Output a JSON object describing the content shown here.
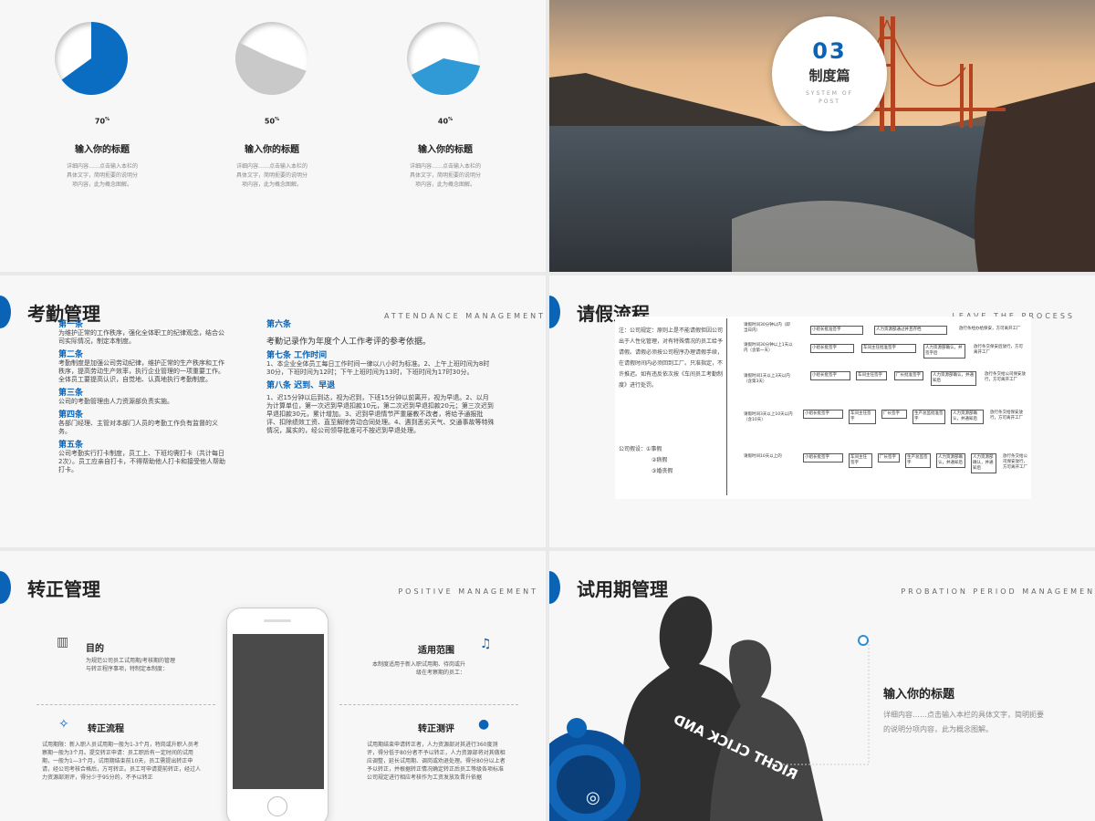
{
  "slide1": {
    "items": [
      {
        "percent_label": "70",
        "percent": 70,
        "color": "#0a6dc2",
        "title": "输入你的标题",
        "desc_lines": [
          "详细内容……点击输入本栏的",
          "具体文字，简明扼要的说明分",
          "项内容，此为概念图解。"
        ]
      },
      {
        "percent_label": "50",
        "percent": 50,
        "color": "#c9c9c9",
        "title": "输入你的标题",
        "desc_lines": [
          "详细内容……点击输入本栏的",
          "具体文字，简明扼要的说明分",
          "项内容，此为概念图解。"
        ]
      },
      {
        "percent_label": "40",
        "percent": 40,
        "color": "#2f9ad6",
        "title": "输入你的标题",
        "desc_lines": [
          "详细内容……点击输入本栏的",
          "具体文字，简明扼要的说明分",
          "项内容，此为概念图解。"
        ]
      }
    ]
  },
  "slide2": {
    "number": "03",
    "title": "制度篇",
    "subtitle": "SYSTEM OF POST"
  },
  "slide3": {
    "title": "考勤管理",
    "subtitle": "ATTENDANCE MANAGEMENT",
    "left": [
      {
        "head": "第一条",
        "body": "为维护正常的工作秩序，强化全体职工的纪律观念，结合公司实际情况，制定本制度。"
      },
      {
        "head": "第二条",
        "body": "考勤制度是加强公司劳动纪律，维护正常的生产秩序和工作秩序，提高劳动生产效率，执行企业管理的一项重要工作。全体员工要提高认识，自觉地、认真地执行考勤制度。"
      },
      {
        "head": "第三条",
        "body": "公司的考勤管理由人力资源部负责实施。"
      },
      {
        "head": "第四条",
        "body": "各部门经理、主管对本部门人员的考勤工作负有监督的义务。"
      },
      {
        "head": "第五条",
        "body": "公司考勤实行打卡制度，员工上、下班均需打卡（共计每日2次）。员工应亲自打卡，不得帮助他人打卡和接受他人帮助打卡。"
      }
    ],
    "right": {
      "h6": "第六条",
      "p6": "考勤记录作为年度个人工作考评的参考依据。",
      "h7": "第七条 工作时间",
      "p7": "1、本企业全体员工每日工作时间一律以八小时为标准。2、上午上班时间为8时30分，下班时间为12时；下午上班时间为13时，下班时间为17时30分。",
      "h8": "第八条 迟到、早退",
      "p8": "1、迟15分钟以后到达，视为迟到，下班15分钟以前离开，视为早退。2、以月为计算单位，第一次迟到早退扣款10元，第二次迟到早退扣款20元；第三次迟到早退扣款30元，累计增加。3、迟到早退情节严重屡教不改者，将给予通报批评、扣除绩效工资、直至解除劳动合同处理。4、遇到恶劣天气、交通事故等特殊情况，属实的，经公司领导批准可不按迟到早退处理。"
    }
  },
  "slide4": {
    "title": "请假流程",
    "subtitle": "LEAVE THE PROCESS",
    "rules": "注：公司规定：原则上是不能请假但因公司出于人性化管理，对有特殊情况的员工给予请假。请假必须按公司程序办理请假手续，在请假时间内必须回到工厂。只准指定，不许推迟。如有违反依次按《车间员工考勤制度》进行处罚。",
    "types_label": "公司假设：",
    "types": [
      "①事假",
      "②病假",
      "③婚丧假"
    ],
    "rows": [
      {
        "cond": "请假时间30分钟以内（即当日内）",
        "steps": [
          "小组长批准签字",
          "人力资源部通过并且存档",
          "放行条经办给保安，方可离开工厂"
        ]
      },
      {
        "cond": "请假时间30分钟以上1天以内（含第一天）",
        "steps": [
          "小组长批签字",
          "车间主任批准签字",
          "人力资源部确认，并签字后",
          "放行条交保安后放行，方可离开工厂"
        ]
      },
      {
        "cond": "请假时间1天以上3天以内（含第3天）",
        "steps": [
          "小组长批签字",
          "车间主任签字",
          "厂长批准签字",
          "人力资源部确认，并通知后",
          "放行条交给公司保安放行，方可离开工厂"
        ]
      },
      {
        "cond": "请假时间3天以上10天以内（含10天）",
        "steps": [
          "小组长批签字",
          "车间主任签字",
          "厂长签字",
          "生产总监批准签字",
          "人力资源部确认，并通知后",
          "放行条交给保安放行，方可离开工厂"
        ]
      },
      {
        "cond": "请假时间10天以上的",
        "steps": [
          "小组长批签字",
          "车间主任签字",
          "厂长签字",
          "生产总监签字",
          "人力资源部确认，并通知后",
          "人力资源部确认，并通知后",
          "放行条交给公司保安放行，方可离开工厂"
        ]
      }
    ]
  },
  "slide5": {
    "title": "转正管理",
    "subtitle": "POSITIVE MANAGEMENT",
    "purpose": {
      "head": "目的",
      "body": "为规范公司员工试用期/考核期的管理与转正程序事项，特制定本制度："
    },
    "scope": {
      "head": "适用范围",
      "body": "本制度适用于新入职试用期、待岗或升级在考察期的员工："
    },
    "process": {
      "head": "转正流程",
      "body": "试用期限：新入职人员试用期一般为1-3个月，特岗或升职人员考察期一般为3个月。提交转正申请：员工职后有一定时间的试用期，一般为1—3个月，试用期结束前10天，员工需提出转正申请，经公司考核合格后，方可转正。员工可申请提前转正，经过人力资源部测评，得分少于95分的，不予以转正"
    },
    "eval": {
      "head": "转正测评",
      "body": "试用期结束申请转正者，人力资源部对其进行360度测评，得分低于80分者不予以转正，人力资源部将对其做相应调整，延长试用期、调岗或劝退处理。得分80分以上者予以转正，并根据转正情况确定转正后员工等级各项标准公司规定进行相应考核作为工资发放及晋升依据"
    }
  },
  "slide6": {
    "title": "试用期管理",
    "subtitle": "PROBATION PERIOD MANAGEMENT",
    "heading": "输入你的标题",
    "desc": "详细内容……点击输入本栏的具体文字，简明扼要的说明分项内容，此为概念图解。",
    "shirt_text": "RIGHT CLICK AND"
  }
}
